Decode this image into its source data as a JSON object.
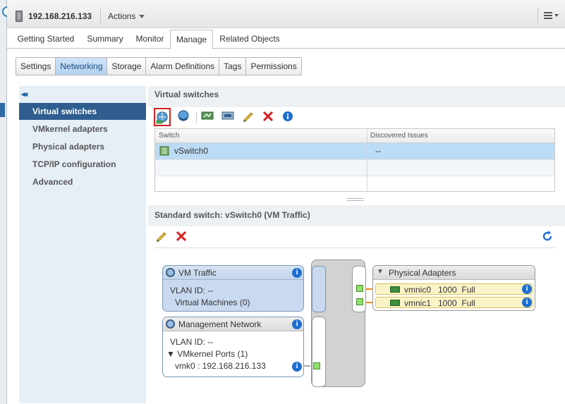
{
  "header": {
    "host_title": "192.168.216.133",
    "actions_label": "Actions"
  },
  "main_tabs": [
    "Getting Started",
    "Summary",
    "Monitor",
    "Manage",
    "Related Objects"
  ],
  "main_tab_active": "Manage",
  "sub_tabs": [
    "Settings",
    "Networking",
    "Storage",
    "Alarm Definitions",
    "Tags",
    "Permissions"
  ],
  "sub_tab_active": "Networking",
  "nav": {
    "collapse_glyph": "◂◂",
    "items": [
      "Virtual switches",
      "VMkernel adapters",
      "Physical adapters",
      "TCP/IP configuration",
      "Advanced"
    ],
    "active": "Virtual switches"
  },
  "virtual_switches": {
    "title": "Virtual switches",
    "columns": [
      "Switch",
      "Discovered Issues"
    ],
    "rows": [
      {
        "switch": "vSwitch0",
        "issues": "--"
      }
    ]
  },
  "standard_switch": {
    "title": "Standard switch: vSwitch0 (VM Traffic)",
    "port_groups": [
      {
        "name": "VM Traffic",
        "vlan": "VLAN ID: --",
        "detail": "Virtual Machines (0)"
      },
      {
        "name": "Management Network",
        "vlan": "VLAN ID: --",
        "detail": "▼ VMkernel Ports (1)",
        "port": "vmk0 : 192.168.216.133"
      }
    ],
    "physical_adapters": {
      "title": "Physical Adapters",
      "nics": [
        {
          "text": "vmnic0   1000  Full"
        },
        {
          "text": "vmnic1   1000  Full"
        }
      ]
    }
  },
  "colors": {
    "nav_active": "#2f5d8f",
    "selected_row": "#bcdbf4",
    "nic_row": "#fbf3c8",
    "traffic_line": "#f08c1e",
    "remove_red": "#d42020"
  }
}
